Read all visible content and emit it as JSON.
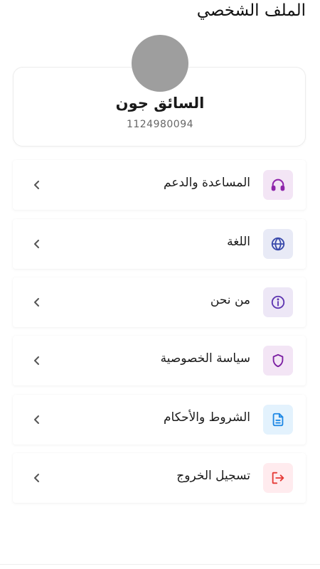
{
  "header": {
    "title": "الملف الشخصي"
  },
  "profile": {
    "name": "السائق جون",
    "phone": "1124980094"
  },
  "menu": [
    {
      "label": "المساعدة والدعم",
      "icon": "headphones-icon",
      "bg": "#f3e5f5",
      "fg": "#8e24aa"
    },
    {
      "label": "اللغة",
      "icon": "globe-icon",
      "bg": "#e8eaf6",
      "fg": "#3949ab"
    },
    {
      "label": "من نحن",
      "icon": "info-icon",
      "bg": "#ede7f6",
      "fg": "#5e35b1"
    },
    {
      "label": "سياسة الخصوصية",
      "icon": "shield-icon",
      "bg": "#f3e5f5",
      "fg": "#7b1fa2"
    },
    {
      "label": "الشروط والأحكام",
      "icon": "document-icon",
      "bg": "#e3f2fd",
      "fg": "#1e88e5"
    },
    {
      "label": "تسجيل الخروج",
      "icon": "logout-icon",
      "bg": "#ffebee",
      "fg": "#e53935"
    }
  ]
}
